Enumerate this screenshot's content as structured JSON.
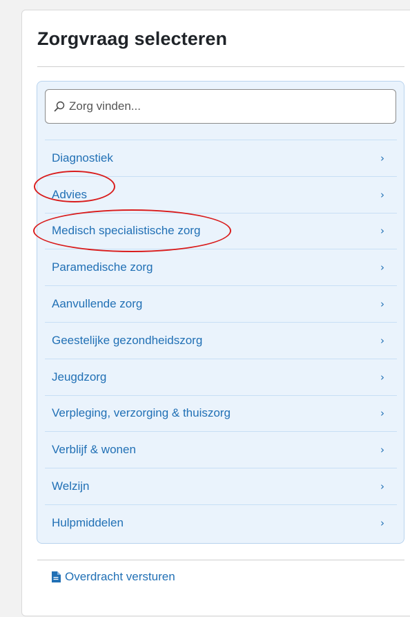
{
  "page": {
    "title": "Zorgvraag selecteren"
  },
  "search": {
    "placeholder": "Zorg vinden..."
  },
  "categories": [
    {
      "label": "Diagnostiek",
      "chevron": "›"
    },
    {
      "label": "Advies",
      "chevron": "›"
    },
    {
      "label": "Medisch specialistische zorg",
      "chevron": "›"
    },
    {
      "label": "Paramedische zorg",
      "chevron": "›"
    },
    {
      "label": "Aanvullende zorg",
      "chevron": "›"
    },
    {
      "label": "Geestelijke gezondheidszorg",
      "chevron": "›"
    },
    {
      "label": "Jeugdzorg",
      "chevron": "›"
    },
    {
      "label": "Verpleging, verzorging & thuiszorg",
      "chevron": "›"
    },
    {
      "label": "Verblijf & wonen",
      "chevron": "›"
    },
    {
      "label": "Welzijn",
      "chevron": "›"
    },
    {
      "label": "Hulpmiddelen",
      "chevron": "›"
    }
  ],
  "footer": {
    "link_label": "Overdracht versturen",
    "icon": "document-icon"
  },
  "annotations": {
    "color": "#d91c1c",
    "highlighted_items": [
      "Advies",
      "Medisch specialistische zorg"
    ]
  },
  "colors": {
    "link": "#2170b5",
    "panel_bg": "#eaf3fc",
    "panel_border": "#b8d3ee"
  }
}
